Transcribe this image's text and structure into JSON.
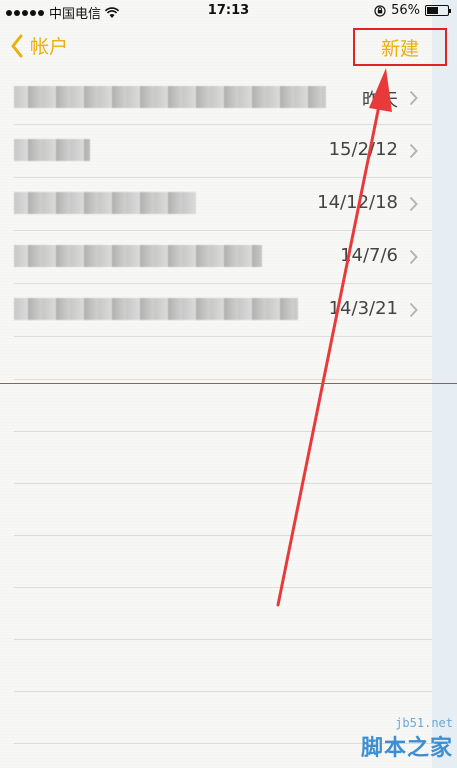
{
  "status_bar": {
    "carrier": "中国电信",
    "time": "17:13",
    "battery": "56%",
    "battery_level": 0.56
  },
  "nav": {
    "back_label": "帐户",
    "new_label": "新建"
  },
  "notes": [
    {
      "date": "昨天"
    },
    {
      "date": "15/2/12"
    },
    {
      "date": "14/12/18"
    },
    {
      "date": "14/7/6"
    },
    {
      "date": "14/3/21"
    }
  ],
  "watermark": {
    "site": "jb51.net",
    "name": "脚本之家"
  },
  "colors": {
    "accent": "#e9b10f",
    "highlight_box": "#e02424",
    "arrow": "#e83a3a",
    "margin_line": "#c84848"
  }
}
